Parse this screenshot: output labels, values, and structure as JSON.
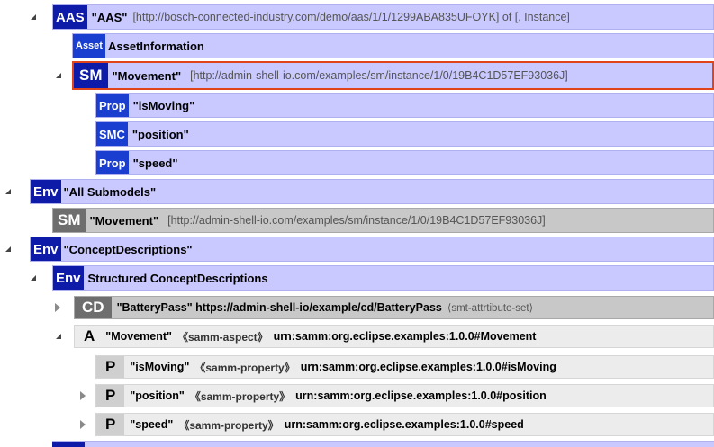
{
  "tree": {
    "aas": {
      "badge": "AAS",
      "name": "\"AAS\"",
      "detail": "[http://bosch-connected-industry.com/demo/aas/1/1/1299ABA835UFOYK] of [, Instance]"
    },
    "asset": {
      "badge": "Asset",
      "name": "AssetInformation"
    },
    "sm_movement": {
      "badge": "SM",
      "name": "\"Movement\"",
      "detail": "[http://admin-shell-io.com/examples/sm/instance/1/0/19B4C1D57EF93036J]"
    },
    "prop_ismoving": {
      "badge": "Prop",
      "name": "\"isMoving\""
    },
    "smc_position": {
      "badge": "SMC",
      "name": "\"position\""
    },
    "prop_speed": {
      "badge": "Prop",
      "name": "\"speed\""
    },
    "env_all_submodels": {
      "badge": "Env",
      "name": "\"All Submodels\""
    },
    "sm_movement_2": {
      "badge": "SM",
      "name": "\"Movement\"",
      "detail": "[http://admin-shell-io.com/examples/sm/instance/1/0/19B4C1D57EF93036J]"
    },
    "env_concept_desc": {
      "badge": "Env",
      "name": "\"ConceptDescriptions\""
    },
    "env_structured": {
      "badge": "Env",
      "name": "Structured ConceptDescriptions"
    },
    "cd_batterypass": {
      "badge": "CD",
      "name": "\"BatteryPass\" https://admin-shell-io/example/cd/BatteryPass",
      "detail": "⟨smt-attrtibute-set⟩"
    },
    "a_movement": {
      "badge": "A",
      "name": "\"Movement\"",
      "kind": "《samm-aspect》",
      "urn": "urn:samm:org.eclipse.examples:1.0.0#Movement"
    },
    "p_ismoving": {
      "badge": "P",
      "name": "\"isMoving\"",
      "kind": "《samm-property》",
      "urn": "urn:samm:org.eclipse.examples:1.0.0#isMoving"
    },
    "p_position": {
      "badge": "P",
      "name": "\"position\"",
      "kind": "《samm-property》",
      "urn": "urn:samm:org.eclipse.examples:1.0.0#position"
    },
    "p_speed": {
      "badge": "P",
      "name": "\"speed\"",
      "kind": "《samm-property》",
      "urn": "urn:samm:org.eclipse.examples:1.0.0#speed"
    }
  },
  "colors": {
    "node_blue": "#c9c9ff",
    "badge_navy": "#0e1aa8",
    "badge_blue": "#1a3fd0",
    "selection": "#e0441a",
    "concept_gray": "#ececec"
  }
}
